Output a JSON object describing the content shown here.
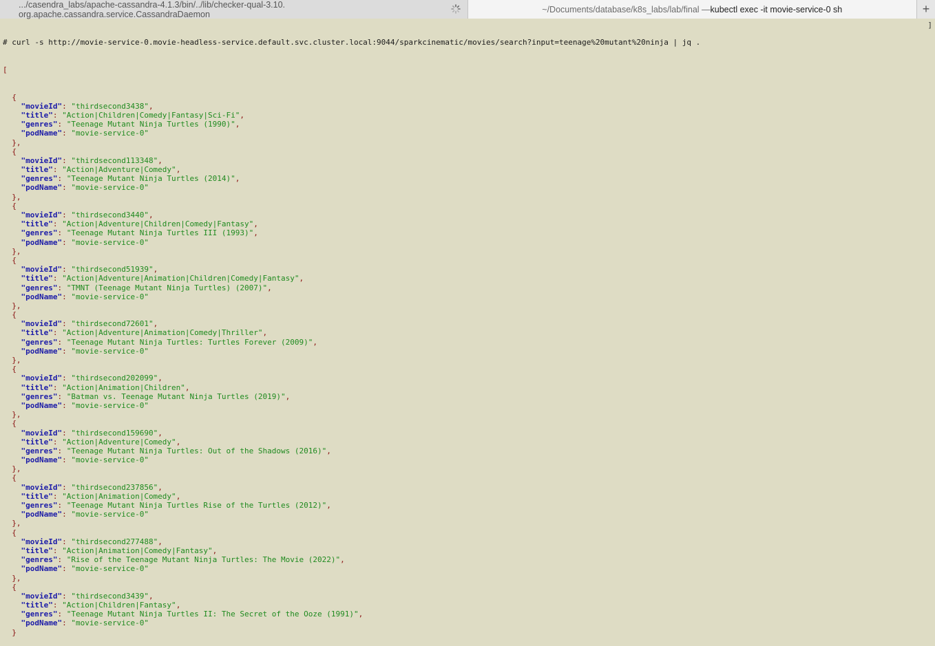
{
  "tabs": [
    {
      "label": ".../casendra_labs/apache-cassandra-4.1.3/bin/../lib/checker-qual-3.10. org.apache.cassandra.service.CassandraDaemon"
    },
    {
      "label_dim": "~/Documents/database/k8s_labs/lab/final — ",
      "label_main": "kubectl exec -it movie-service-0 sh"
    }
  ],
  "new_tab_label": "+",
  "prompt": "# ",
  "command": "curl -s http://movie-service-0.movie-headless-service.default.svc.cluster.local:9044/sparkcinematic/movies/search?input=teenage%20mutant%20ninja | jq .",
  "keys": {
    "movieId": "\"movieId\"",
    "title": "\"title\"",
    "genres": "\"genres\"",
    "podName": "\"podName\""
  },
  "results": [
    {
      "movieId": "\"thirdsecond3438\"",
      "title": "\"Action|Children|Comedy|Fantasy|Sci-Fi\"",
      "genres": "\"Teenage Mutant Ninja Turtles (1990)\"",
      "podName": "\"movie-service-0\""
    },
    {
      "movieId": "\"thirdsecond113348\"",
      "title": "\"Action|Adventure|Comedy\"",
      "genres": "\"Teenage Mutant Ninja Turtles (2014)\"",
      "podName": "\"movie-service-0\""
    },
    {
      "movieId": "\"thirdsecond3440\"",
      "title": "\"Action|Adventure|Children|Comedy|Fantasy\"",
      "genres": "\"Teenage Mutant Ninja Turtles III (1993)\"",
      "podName": "\"movie-service-0\""
    },
    {
      "movieId": "\"thirdsecond51939\"",
      "title": "\"Action|Adventure|Animation|Children|Comedy|Fantasy\"",
      "genres": "\"TMNT (Teenage Mutant Ninja Turtles) (2007)\"",
      "podName": "\"movie-service-0\""
    },
    {
      "movieId": "\"thirdsecond72601\"",
      "title": "\"Action|Adventure|Animation|Comedy|Thriller\"",
      "genres": "\"Teenage Mutant Ninja Turtles: Turtles Forever (2009)\"",
      "podName": "\"movie-service-0\""
    },
    {
      "movieId": "\"thirdsecond202099\"",
      "title": "\"Action|Animation|Children\"",
      "genres": "\"Batman vs. Teenage Mutant Ninja Turtles (2019)\"",
      "podName": "\"movie-service-0\""
    },
    {
      "movieId": "\"thirdsecond159690\"",
      "title": "\"Action|Adventure|Comedy\"",
      "genres": "\"Teenage Mutant Ninja Turtles: Out of the Shadows (2016)\"",
      "podName": "\"movie-service-0\""
    },
    {
      "movieId": "\"thirdsecond237856\"",
      "title": "\"Action|Animation|Comedy\"",
      "genres": "\"Teenage Mutant Ninja Turtles Rise of the Turtles (2012)\"",
      "podName": "\"movie-service-0\""
    },
    {
      "movieId": "\"thirdsecond277488\"",
      "title": "\"Action|Animation|Comedy|Fantasy\"",
      "genres": "\"Rise of the Teenage Mutant Ninja Turtles: The Movie (2022)\"",
      "podName": "\"movie-service-0\""
    },
    {
      "movieId": "\"thirdsecond3439\"",
      "title": "\"Action|Children|Fantasy\"",
      "genres": "\"Teenage Mutant Ninja Turtles II: The Secret of the Ooze (1991)\"",
      "podName": "\"movie-service-0\""
    }
  ],
  "colors": {
    "background": "#dedcc4",
    "key": "#1b1ba8",
    "string": "#1f8a1f",
    "punctuation": "#8a1212"
  }
}
